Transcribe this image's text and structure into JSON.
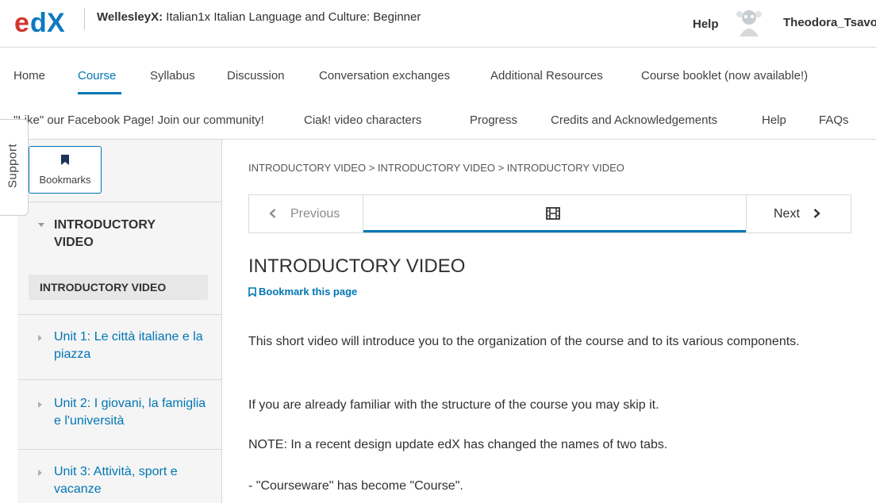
{
  "header": {
    "logo_text": "edX",
    "course_org": "WellesleyX:",
    "course_name": "Italian1x Italian Language and Culture: Beginner",
    "help_label": "Help",
    "username": "Theodora_Tsavo"
  },
  "nav": {
    "row1": [
      "Home",
      "Course",
      "Syllabus",
      "Discussion",
      "Conversation exchanges",
      "Additional Resources",
      "Course booklet (now available!)"
    ],
    "row2": [
      "\"Like\" our Facebook Page! Join our community!",
      "Ciak! video characters",
      "Progress",
      "Credits and Acknowledgements",
      "Help",
      "FAQs"
    ],
    "active": "Course"
  },
  "support_label": "Support",
  "sidebar": {
    "bookmarks_label": "Bookmarks",
    "section_title": "INTRODUCTORY VIDEO",
    "subsection_title": "INTRODUCTORY VIDEO",
    "units": [
      "Unit 1: Le città italiane e la piazza",
      "Unit 2: I giovani, la famiglia e l'università",
      "Unit 3: Attività, sport e vacanze"
    ]
  },
  "main": {
    "breadcrumb": "INTRODUCTORY VIDEO > INTRODUCTORY VIDEO > INTRODUCTORY VIDEO",
    "previous_label": "Previous",
    "next_label": "Next",
    "page_title": "INTRODUCTORY VIDEO",
    "bookmark_page_label": "Bookmark this page",
    "paragraphs": [
      "This short video will introduce you to the organization of the course and to its various components.",
      "If you are already familiar with the structure of the course you may skip it.",
      "NOTE: In a recent design update edX has changed the names of two tabs.",
      "- \"Courseware\" has become \"Course\"."
    ]
  },
  "colors": {
    "accent": "#0075b4",
    "logo_red": "#d2362f",
    "logo_blue": "#0d79c2"
  },
  "icons": [
    "bookmark-icon",
    "chevron-left-icon",
    "film-icon",
    "chevron-right-icon",
    "caret-down-icon",
    "caret-right-icon"
  ]
}
